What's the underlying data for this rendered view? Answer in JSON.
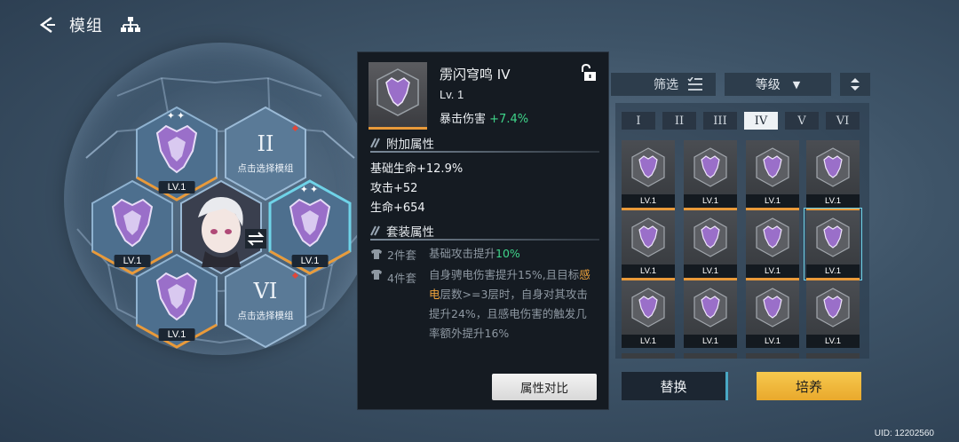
{
  "header": {
    "title": "模组",
    "back_icon": "back-arrow-icon",
    "tree_icon": "hierarchy-icon"
  },
  "hex_slots": [
    {
      "level": "LV.1",
      "stars": "✦✦",
      "filled": true,
      "bar_color": "#e99a3a"
    },
    {
      "slot_label": "II",
      "hint": "点击选择模组",
      "filled": false,
      "red_dot": true
    },
    {
      "level": "LV.1",
      "filled": true,
      "bar_color": "#e99a3a"
    },
    {
      "level": "LV.1",
      "stars": "✦✦",
      "filled": true,
      "selected": true,
      "bar_color": "#e99a3a"
    },
    {
      "level": "LV.1",
      "filled": true,
      "bar_color": "#e99a3a"
    },
    {
      "slot_label": "VI",
      "hint": "点击选择模组",
      "filled": false,
      "red_dot": true
    }
  ],
  "swap_icon": "swap-arrows-icon",
  "detail": {
    "name": "雳闪穹鸣 IV",
    "level": "Lv. 1",
    "main_stat_label": "暴击伤害",
    "main_stat_value": "+7.4%",
    "lock_icon": "unlock-icon",
    "extra_title": "附加属性",
    "extra_attrs": [
      "基础生命+12.9%",
      "攻击+52",
      "生命+654"
    ],
    "set_title": "套装属性",
    "set2_tag": "2件套",
    "set2_prefix": "基础攻击提升",
    "set2_value": "10%",
    "set4_tag": "4件套",
    "set4_part1": "自身骋电伤害提升15%,且目标",
    "set4_keyword": "感电",
    "set4_part2": "层数>=3层时，自身对其攻击提升24%，且感电伤害的触发几率额外提升16%",
    "compare_button": "属性对比"
  },
  "right_panel": {
    "filter_label": "筛选",
    "filter_icon": "filter-list-icon",
    "sort_select": "等级",
    "sort_order_icon": "sort-updown-icon",
    "tabs": [
      "I",
      "II",
      "III",
      "IV",
      "V",
      "VI"
    ],
    "active_tab": "IV",
    "module_level": "LV.1",
    "replace_button": "替换",
    "train_button": "培养"
  },
  "colors": {
    "accent_orange": "#e99a3a",
    "accent_cyan": "#6fd3e8",
    "gold": "#f0b63a",
    "green": "#3fd58a"
  },
  "uid": "UID: 12202560"
}
